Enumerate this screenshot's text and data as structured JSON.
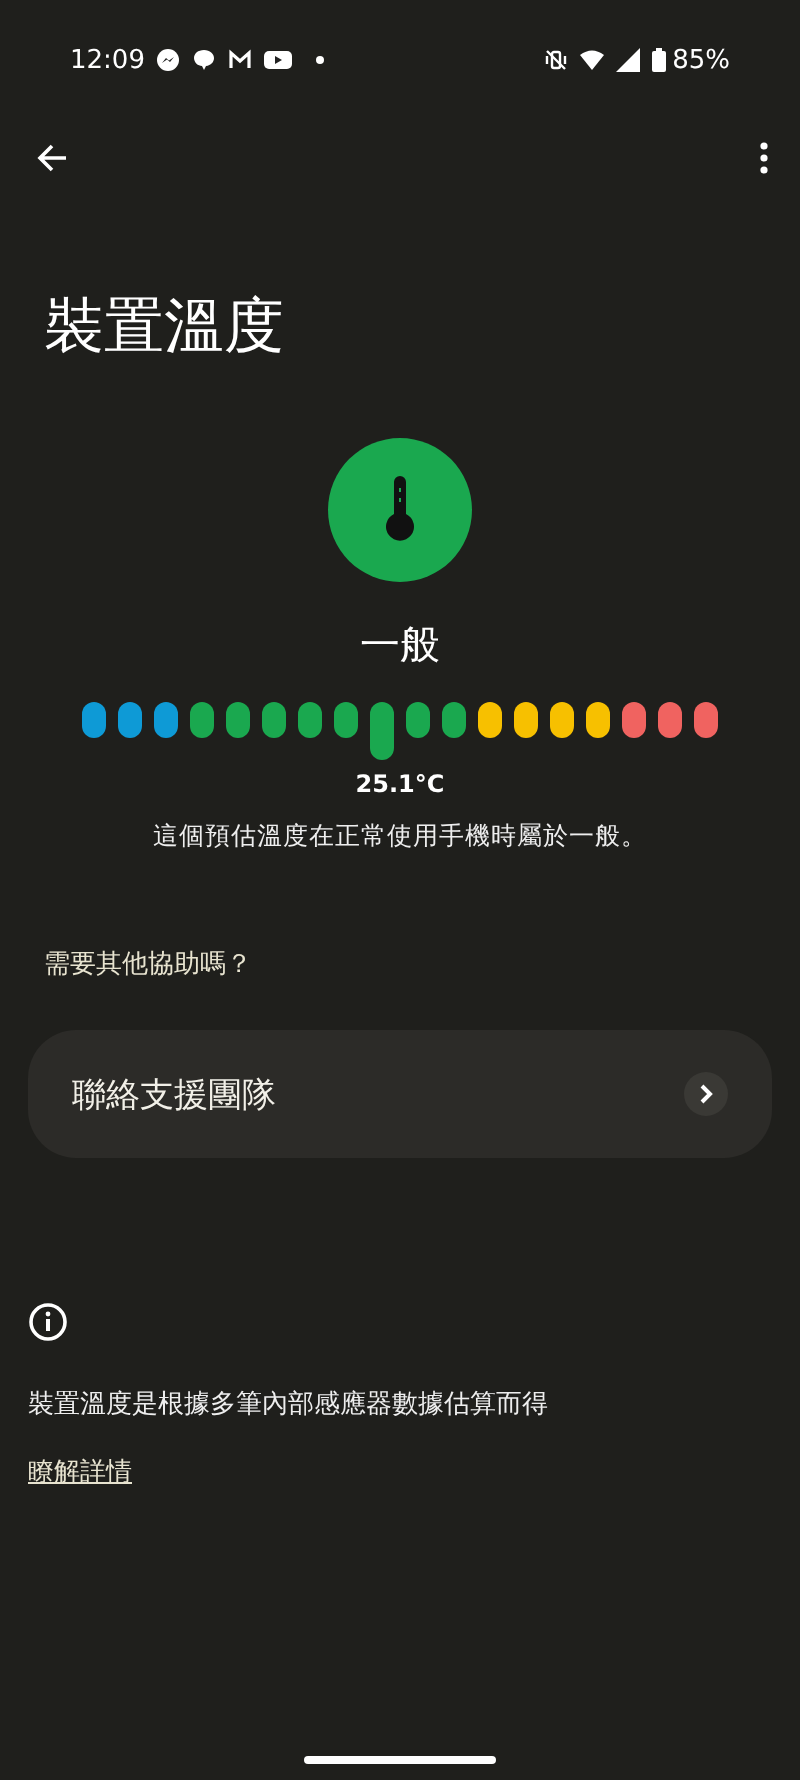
{
  "status_bar": {
    "time": "12:09",
    "battery": "85%"
  },
  "title": "裝置溫度",
  "status": {
    "label": "一般",
    "color": "#1aa84f"
  },
  "scale": [
    {
      "color": "#0e9ad6",
      "selected": false
    },
    {
      "color": "#0e9ad6",
      "selected": false
    },
    {
      "color": "#0e9ad6",
      "selected": false
    },
    {
      "color": "#1aa84f",
      "selected": false
    },
    {
      "color": "#1aa84f",
      "selected": false
    },
    {
      "color": "#1aa84f",
      "selected": false
    },
    {
      "color": "#1aa84f",
      "selected": false
    },
    {
      "color": "#1aa84f",
      "selected": false
    },
    {
      "color": "#1aa84f",
      "selected": true
    },
    {
      "color": "#1aa84f",
      "selected": false
    },
    {
      "color": "#1aa84f",
      "selected": false
    },
    {
      "color": "#f7c000",
      "selected": false
    },
    {
      "color": "#f7c000",
      "selected": false
    },
    {
      "color": "#f7c000",
      "selected": false
    },
    {
      "color": "#f7c000",
      "selected": false
    },
    {
      "color": "#f06360",
      "selected": false
    },
    {
      "color": "#f06360",
      "selected": false
    },
    {
      "color": "#f06360",
      "selected": false
    }
  ],
  "temperature": "25.1°C",
  "description": "這個預估溫度在正常使用手機時屬於一般。",
  "help_heading": "需要其他協助嗎？",
  "support_card": {
    "label": "聯絡支援團隊"
  },
  "footer_note": "裝置溫度是根據多筆內部感應器數據估算而得",
  "learn_more": "瞭解詳情"
}
